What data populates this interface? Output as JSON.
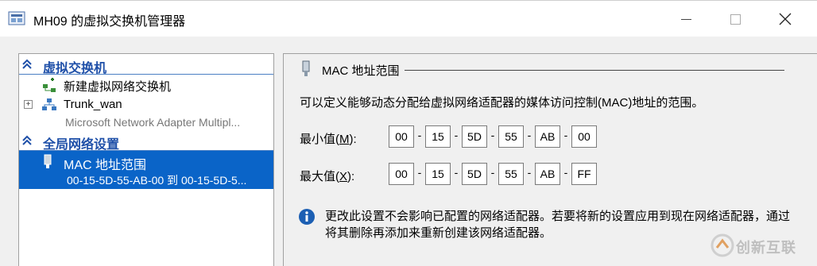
{
  "window": {
    "title": "MH09 的虚拟交换机管理器"
  },
  "sidebar": {
    "section1": {
      "label": "虚拟交换机"
    },
    "new_switch": {
      "label": "新建虚拟网络交换机"
    },
    "switch_item": {
      "label": "Trunk_wan",
      "description": "Microsoft Network Adapter Multipl..."
    },
    "section2": {
      "label": "全局网络设置"
    },
    "selected": {
      "label": "MAC 地址范围",
      "value": "00-15-5D-55-AB-00 到 00-15-5D-5..."
    }
  },
  "main": {
    "group_title": "MAC 地址范围",
    "description": "可以定义能够动态分配给虚拟网络适配器的媒体访问控制(MAC)地址的范围。",
    "min": {
      "label_prefix": "最小值(",
      "label_key": "M",
      "label_suffix": "):",
      "octets": [
        "00",
        "15",
        "5D",
        "55",
        "AB",
        "00"
      ]
    },
    "max": {
      "label_prefix": "最大值(",
      "label_key": "X",
      "label_suffix": "):",
      "octets": [
        "00",
        "15",
        "5D",
        "55",
        "AB",
        "FF"
      ]
    },
    "info": "更改此设置不会影响已配置的网络适配器。若要将新的设置应用到现在网络适配器，通过将其删除再添加来重新创建该网络适配器。"
  },
  "watermark": {
    "text": "创新互联"
  },
  "colors": {
    "accent": "#0a64c8",
    "header_text": "#1e4fa8",
    "info_blue": "#1c5fb3"
  }
}
